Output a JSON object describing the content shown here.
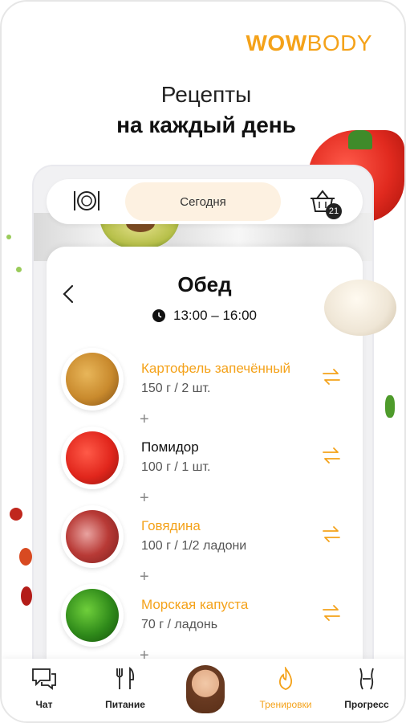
{
  "brand": {
    "bold": "WOW",
    "light": "BODY"
  },
  "headline": {
    "line1": "Рецепты",
    "line2": "на каждый день"
  },
  "top_bar": {
    "today_label": "Сегодня",
    "basket_count": "21"
  },
  "meal": {
    "title": "Обед",
    "time": "13:00 – 16:00",
    "items": [
      {
        "name": "Картофель запечённый",
        "amount": "150 г / 2 шт.",
        "highlight": true
      },
      {
        "name": "Помидор",
        "amount": "100 г / 1 шт.",
        "highlight": false
      },
      {
        "name": "Говядина",
        "amount": "100 г / 1/2 ладони",
        "highlight": true
      },
      {
        "name": "Морская капуста",
        "amount": "70 г / ладонь",
        "highlight": true
      }
    ],
    "plus": "+"
  },
  "nav": {
    "chat": "Чат",
    "food": "Питание",
    "workouts": "Тренировки",
    "progress": "Прогресс"
  },
  "colors": {
    "accent": "#f4a21a",
    "pill": "#fdf1e1"
  }
}
